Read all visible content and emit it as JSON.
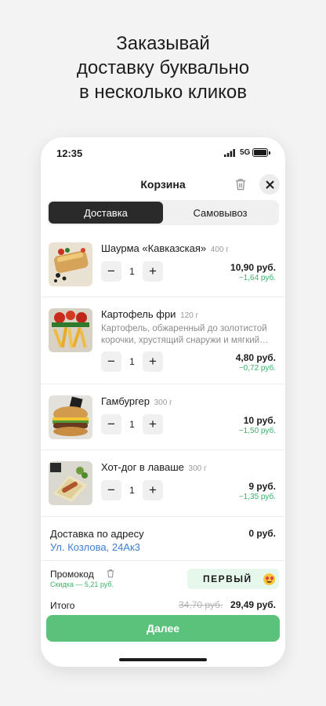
{
  "headline": {
    "line1": "Заказывай",
    "line2": "доставку буквально",
    "line3": "в несколько кликов"
  },
  "status_bar": {
    "time": "12:35",
    "network": "5G"
  },
  "cart": {
    "title": "Корзина",
    "tabs": [
      {
        "label": "Доставка",
        "active": true
      },
      {
        "label": "Самовывоз",
        "active": false
      }
    ],
    "items": [
      {
        "name": "Шаурма «Кавказская»",
        "weight": "400 г",
        "description": "",
        "quantity": "1",
        "price": "10,90 руб.",
        "discount": "−1,64 руб.",
        "image": "shawarma-photo"
      },
      {
        "name": "Картофель фри",
        "weight": "120 г",
        "description_line1": "Картофель, обжаренный до золотистой",
        "description_line2": "корочки, хрустящий снаружи и мягкий…",
        "quantity": "1",
        "price": "4,80 руб.",
        "discount": "−0,72 руб.",
        "image": "fries-photo"
      },
      {
        "name": "Гамбургер",
        "weight": "300 г",
        "description": "",
        "quantity": "1",
        "price": "10 руб.",
        "discount": "−1,50 руб.",
        "image": "burger-photo"
      },
      {
        "name": "Хот-дог в лаваше",
        "weight": "300 г",
        "description": "",
        "quantity": "1",
        "price": "9 руб.",
        "discount": "−1,35 руб.",
        "image": "hotdog-photo"
      }
    ],
    "delivery": {
      "label": "Доставка по адресу",
      "address": "Ул. Козлова, 24Ак3",
      "price": "0 руб."
    },
    "promo": {
      "label": "Промокод",
      "discount": "Скидка — 5,21 руб.",
      "code": "ПЕРВЫЙ",
      "emoji": "heart-eyes-emoji"
    },
    "total": {
      "label": "Итого",
      "old_price": "34,70 руб.",
      "new_price": "29,49 руб."
    },
    "next_button": "Далее"
  },
  "colors": {
    "accent_green": "#5bc27c",
    "discount_green": "#3bb36a",
    "link_blue": "#3b7ed6",
    "active_tab": "#2a2a2a"
  }
}
